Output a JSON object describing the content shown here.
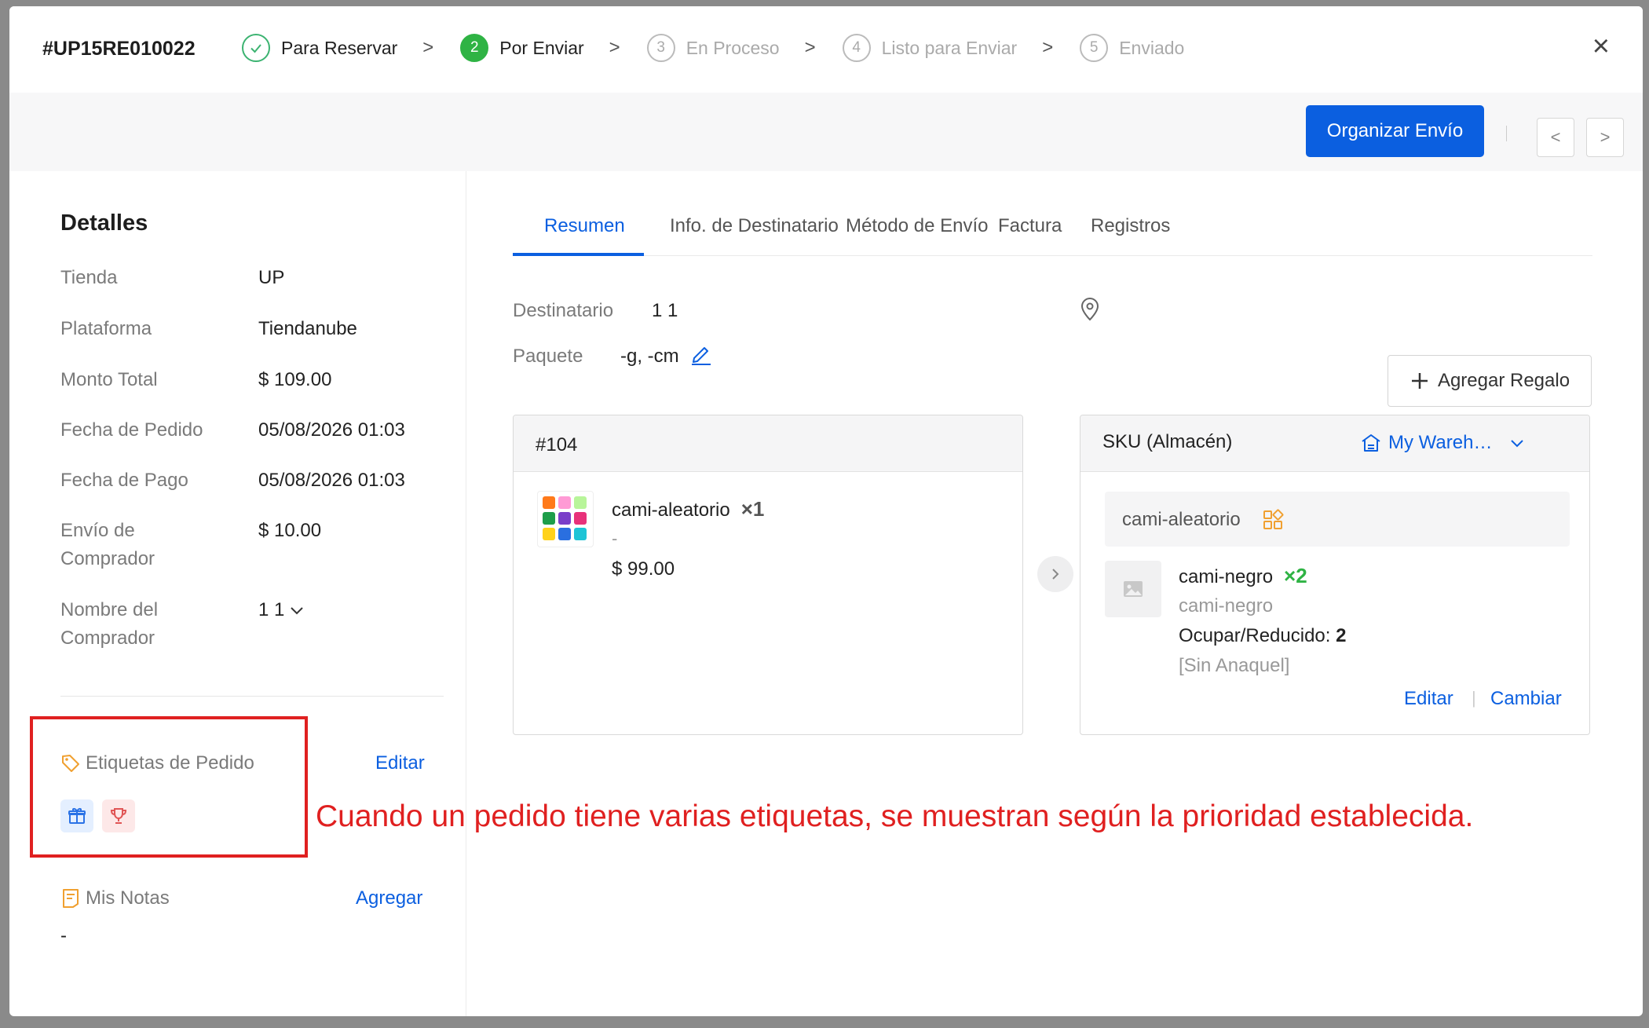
{
  "header": {
    "order_id": "#UP15RE010022",
    "steps": [
      {
        "num": "",
        "label": "Para Reservar",
        "state": "done"
      },
      {
        "num": "2",
        "label": "Por Enviar",
        "state": "active"
      },
      {
        "num": "3",
        "label": "En Proceso",
        "state": "pending"
      },
      {
        "num": "4",
        "label": "Listo para Enviar",
        "state": "pending"
      },
      {
        "num": "5",
        "label": "Enviado",
        "state": "pending"
      }
    ],
    "separator": ">",
    "close": "×"
  },
  "actionbar": {
    "primary_label": "Organizar Envío",
    "prev_label": "<",
    "next_label": ">"
  },
  "details": {
    "title": "Detalles",
    "rows": [
      {
        "key": "Tienda",
        "value": "UP"
      },
      {
        "key": "Plataforma",
        "value": "Tiendanube"
      },
      {
        "key": "Monto Total",
        "value": "$ 109.00"
      },
      {
        "key": "Fecha de Pedido",
        "value": "05/08/2026 01:03"
      },
      {
        "key": "Fecha de Pago",
        "value": "05/08/2026 01:03"
      },
      {
        "key_line1": "Envío de",
        "key_line2": "Comprador",
        "value": "$ 10.00"
      },
      {
        "key_line1": "Nombre del",
        "key_line2": "Comprador",
        "value": "1 1"
      }
    ]
  },
  "tags": {
    "label": "Etiquetas de Pedido",
    "edit_label": "Editar",
    "icons": [
      "gift-icon",
      "trophy-icon"
    ]
  },
  "notes": {
    "label": "Mis Notas",
    "add_label": "Agregar",
    "value": "-"
  },
  "tabs": [
    "Resumen",
    "Info. de Destinatario",
    "Método de Envío",
    "Factura",
    "Registros"
  ],
  "summary": {
    "recipient_label": "Destinatario",
    "recipient_value": "1 1",
    "package_label": "Paquete",
    "package_value": "-g, -cm",
    "add_gift_label": "Agregar Regalo"
  },
  "order_card": {
    "title": "#104",
    "item_name": "cami-aleatorio",
    "item_qty": "×1",
    "item_variant": "-",
    "item_price": "$ 99.00"
  },
  "sku_card": {
    "title": "SKU (Almacén)",
    "warehouse": "My Wareh…",
    "sku_group": "cami-aleatorio",
    "sku_name": "cami-negro",
    "sku_qty": "×2",
    "sku_sub": "cami-negro",
    "occupy_label": "Ocupar/Reducido:",
    "occupy_value": "2",
    "shelf": "[Sin Anaquel]",
    "edit_label": "Editar",
    "divider": "|",
    "change_label": "Cambiar"
  },
  "annotation": "Cuando un pedido tiene varias etiquetas, se muestran según la prioridad establecida.",
  "colors": {
    "primary": "#0b5fe0",
    "success": "#2fb344",
    "annotation_red": "#e02020",
    "tag_orange": "#f0a030"
  }
}
